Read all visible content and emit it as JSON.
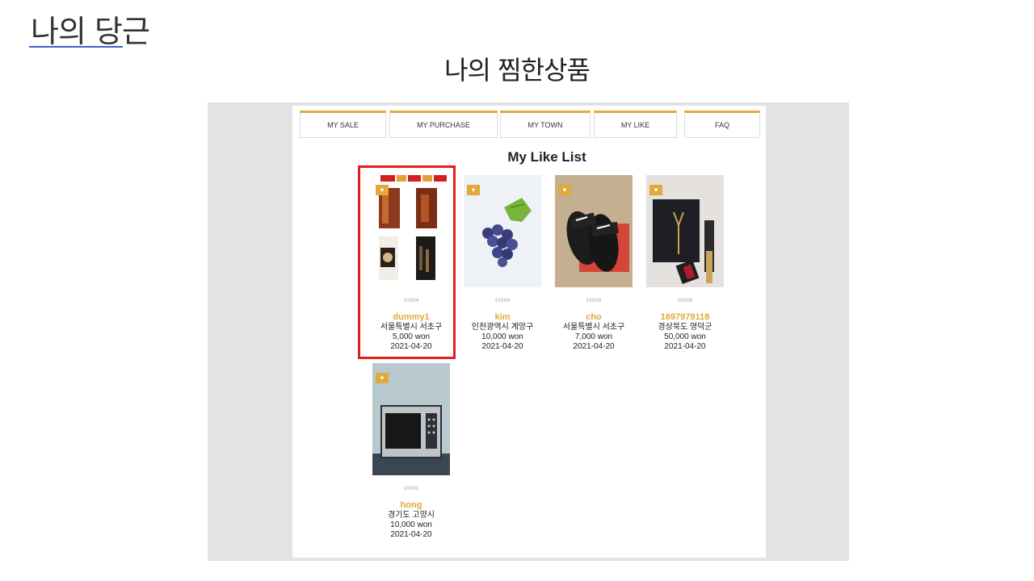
{
  "slide": {
    "title": "나의 당근",
    "subtitle": "나의 찜한상품"
  },
  "nav": {
    "tabs": [
      {
        "label": "MY SALE"
      },
      {
        "label": "MY PURCHASE"
      },
      {
        "label": "MY TOWN"
      },
      {
        "label": "MY LIKE"
      },
      {
        "label": "FAQ"
      }
    ]
  },
  "like_list": {
    "title": "My Like List",
    "heart_glyph": "♥",
    "items": [
      {
        "product_no": "10004",
        "seller": "dummy1",
        "location": "서울특별시 서초구",
        "price": "5,000 won",
        "date": "2021-04-20",
        "image": "food-collage-image"
      },
      {
        "product_no": "10004",
        "seller": "kim",
        "location": "인천광역시 계양구",
        "price": "10,000 won",
        "date": "2021-04-20",
        "image": "grapes-image"
      },
      {
        "product_no": "10008",
        "seller": "cho",
        "location": "서울특별시 서초구",
        "price": "7,000 won",
        "date": "2021-04-20",
        "image": "slippers-image"
      },
      {
        "product_no": "10006",
        "seller": "1697979118",
        "location": "경상북도 영덕군",
        "price": "50,000 won",
        "date": "2021-04-20",
        "image": "wallet-lipstick-image"
      },
      {
        "product_no": "10001",
        "seller": "hong",
        "location": "경기도 고양시",
        "price": "10,000 won",
        "date": "2021-04-20",
        "image": "microwave-image"
      }
    ]
  },
  "colors": {
    "accent": "#e0a93a",
    "highlight": "#e41d1d",
    "title_underline": "#3b64c8"
  }
}
